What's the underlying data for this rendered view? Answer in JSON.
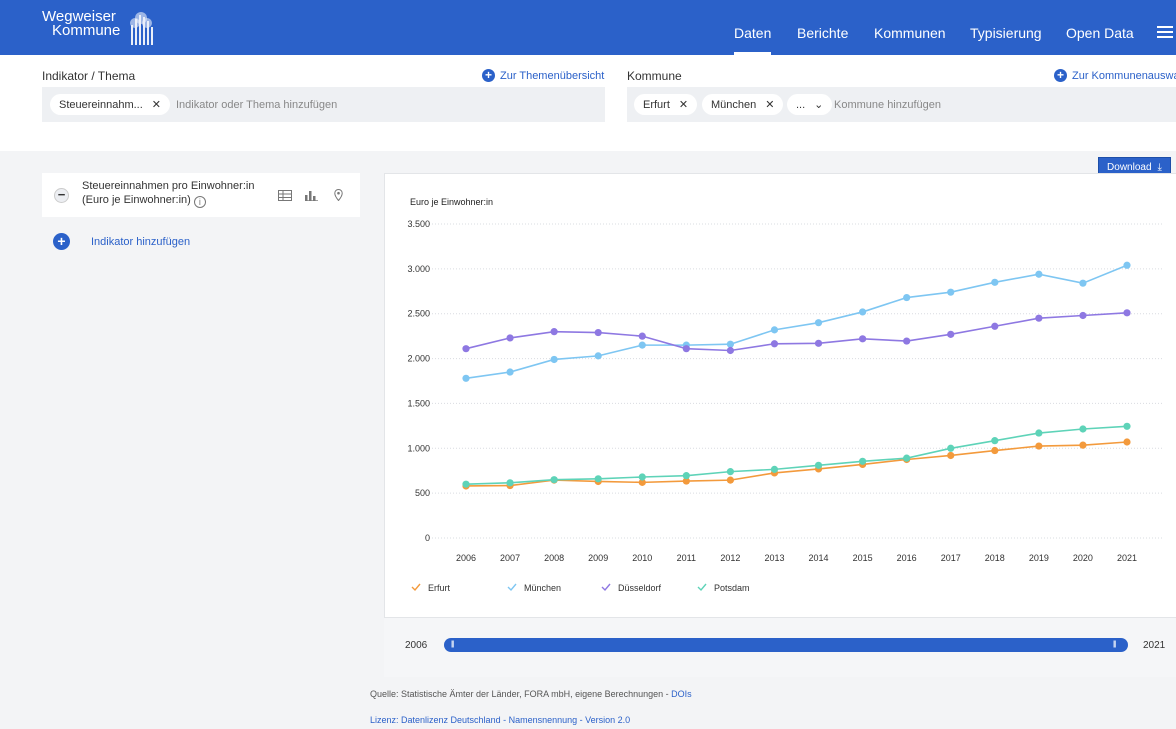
{
  "header": {
    "logo_line1": "Wegweiser",
    "logo_line2": "Kommune",
    "nav": [
      "Daten",
      "Berichte",
      "Kommunen",
      "Typisierung",
      "Open Data"
    ],
    "active_nav": "Daten"
  },
  "indicator_section": {
    "label": "Indikator / Thema",
    "link": "Zur Themenübersicht",
    "chip": "Steuereinnahm...",
    "placeholder": "Indikator oder Thema hinzufügen"
  },
  "kommune_section": {
    "label": "Kommune",
    "link": "Zur Kommunenauswa",
    "chips": [
      "Erfurt",
      "München",
      "..."
    ],
    "placeholder": "Kommune hinzufügen"
  },
  "sidebar": {
    "indicator_line1": "Steuereinnahmen pro Einwohner:in",
    "indicator_line2": "(Euro je Einwohner:in)",
    "add_indicator": "Indikator hinzufügen"
  },
  "download_label": "Download",
  "chart_data": {
    "type": "line",
    "ylabel": "Euro je Einwohner:in",
    "ylim": [
      0,
      3500
    ],
    "yticks": [
      0,
      500,
      1000,
      1500,
      2000,
      2500,
      3000,
      3500
    ],
    "ytick_labels": [
      "0",
      "500",
      "1.000",
      "1.500",
      "2.000",
      "2.500",
      "3.000",
      "3.500"
    ],
    "x": [
      2006,
      2007,
      2008,
      2009,
      2010,
      2011,
      2012,
      2013,
      2014,
      2015,
      2016,
      2017,
      2018,
      2019,
      2020,
      2021
    ],
    "grid": true,
    "legend_position": "bottom-left",
    "series": [
      {
        "name": "Erfurt",
        "color": "#f39a3c",
        "values": [
          580,
          585,
          645,
          630,
          620,
          635,
          645,
          725,
          770,
          820,
          875,
          920,
          975,
          1025,
          1035,
          1070
        ]
      },
      {
        "name": "München",
        "color": "#7ec6f2",
        "values": [
          1780,
          1850,
          1990,
          2030,
          2150,
          2150,
          2160,
          2320,
          2400,
          2520,
          2680,
          2740,
          2850,
          2940,
          2840,
          3040
        ]
      },
      {
        "name": "Düsseldorf",
        "color": "#8e78e2",
        "values": [
          2110,
          2230,
          2300,
          2290,
          2250,
          2110,
          2090,
          2165,
          2170,
          2220,
          2195,
          2270,
          2360,
          2450,
          2480,
          2510
        ]
      },
      {
        "name": "Potsdam",
        "color": "#5ed3b8",
        "values": [
          600,
          615,
          650,
          660,
          680,
          695,
          740,
          765,
          810,
          855,
          890,
          1000,
          1085,
          1170,
          1215,
          1245
        ]
      }
    ]
  },
  "slider": {
    "start": "2006",
    "end": "2021"
  },
  "footer": {
    "source_prefix": "Quelle: Statistische Ämter der Länder, FORA mbH, eigene Berechnungen - ",
    "source_link": "DOIs",
    "license": "Lizenz: Datenlizenz Deutschland - Namensnennung - Version 2.0"
  }
}
